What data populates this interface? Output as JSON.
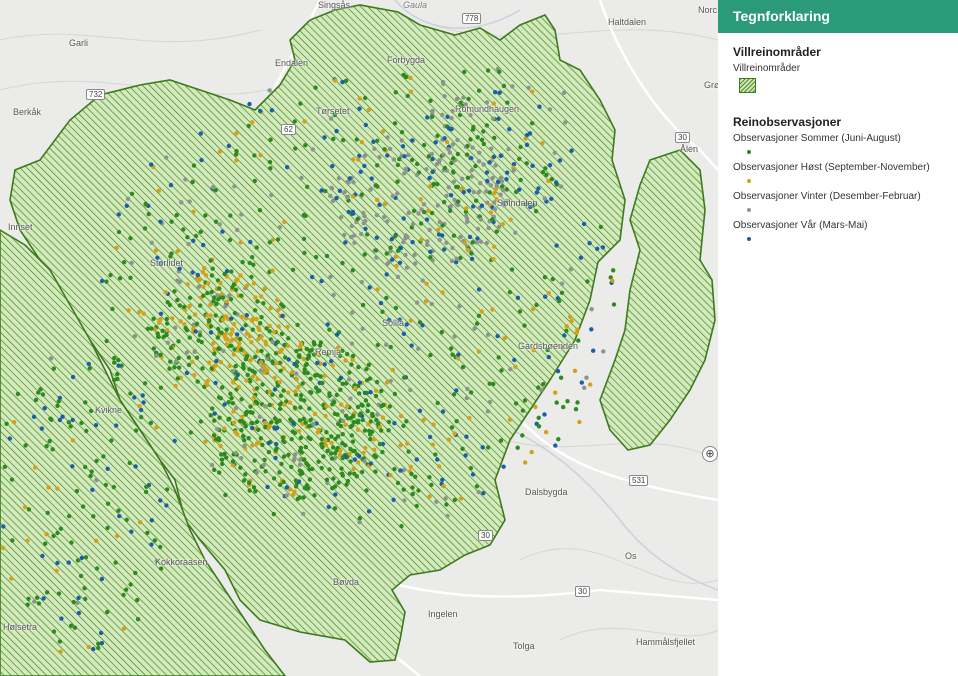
{
  "legend": {
    "title": "Tegnforklaring",
    "area_section": "Villreinområder",
    "area_item": "Villreinområder",
    "obs_section": "Reinobservasjoner",
    "observations": [
      {
        "label": "Observasjoner Sommer (Juni-August)",
        "color": "#2e8a1f"
      },
      {
        "label": "Observasjoner Høst (September-November)",
        "color": "#d4a017"
      },
      {
        "label": "Observasjoner Vinter (Desember-Februar)",
        "color": "#8c948c"
      },
      {
        "label": "Observasjoner Vår (Mars-Mai)",
        "color": "#1a5fa8"
      }
    ]
  },
  "map": {
    "places": [
      "Singsås",
      "Gaula",
      "Haltdalen",
      "Garli",
      "Endalen",
      "Forbygda",
      "Berkåk",
      "Tørsetet",
      "Romundhaugen",
      "Ålen",
      "Innset",
      "Storlidet",
      "Sølndalen",
      "Gardsbøenden",
      "Kvikne",
      "Dalsbygda",
      "Os",
      "Kokkoraasen",
      "Bøvda",
      "Hølsetra",
      "Ingelen",
      "Tolga",
      "Hammålsfjellet",
      "Sollia",
      "Norc",
      "Grø",
      "Remja"
    ],
    "shields": [
      "778",
      "732",
      "62",
      "30",
      "30",
      "531",
      "30"
    ],
    "zoom_symbol": "⊕"
  }
}
